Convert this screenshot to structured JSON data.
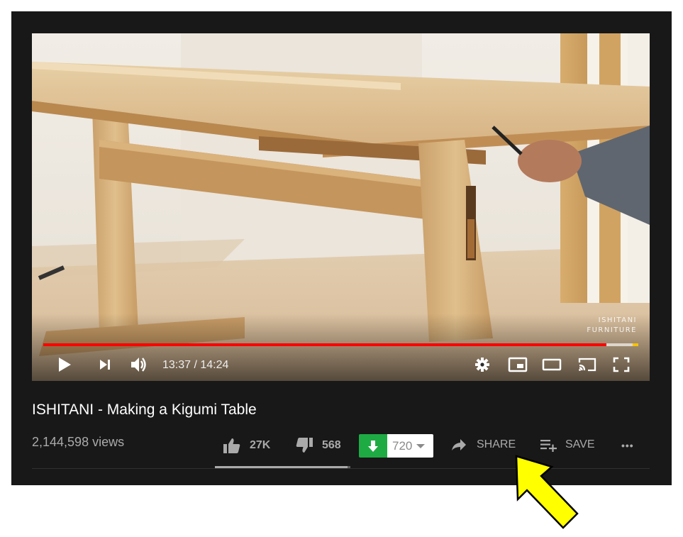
{
  "video": {
    "watermark_line1": "ISHITANI",
    "watermark_line2": "FURNITURE",
    "current_time": "13:37",
    "duration": "14:24",
    "time_display": "13:37 / 14:24",
    "played_fraction": 0.946,
    "buffered_fraction": 0.99,
    "controls": {
      "play": "play-icon",
      "next": "next-icon",
      "volume": "volume-icon",
      "settings": "gear-icon",
      "miniplayer": "miniplayer-icon",
      "theater": "theater-mode-icon",
      "cast": "cast-icon",
      "fullscreen": "fullscreen-icon"
    }
  },
  "info": {
    "title": "ISHITANI - Making a Kigumi Table",
    "views": "2,144,598 views",
    "likes": "27K",
    "dislikes": "568",
    "like_fraction": 0.979,
    "download_count": "720",
    "share_label": "SHARE",
    "save_label": "SAVE",
    "more_label": "•••"
  },
  "colors": {
    "background": "#181818",
    "progress_played": "#ff0000",
    "download_green": "#1fab44",
    "annotation_arrow": "#ffff00"
  }
}
